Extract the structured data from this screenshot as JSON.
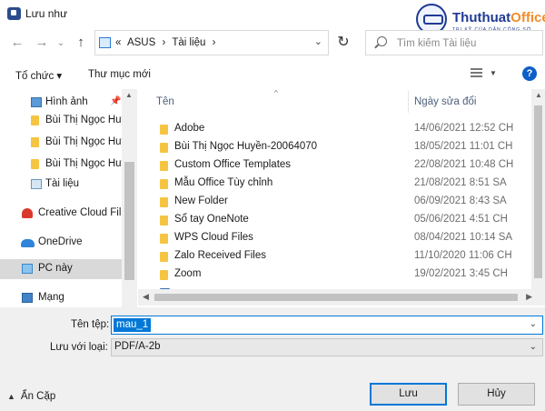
{
  "window": {
    "title": "Lưu như"
  },
  "watermark": {
    "brand_part1": "Thuthuat",
    "brand_part2": "Office",
    "tagline": "TRI KỸ CỦA DÂN CÔNG SỞ"
  },
  "address": {
    "overflow": "«",
    "crumbs": [
      "ASUS",
      "›",
      "Tài liệu",
      "›"
    ],
    "refresh_icon": "refresh-icon"
  },
  "search": {
    "placeholder": "Tìm kiếm Tài liệu"
  },
  "toolbar": {
    "organize": "Tổ chức ▾",
    "new_folder": "Thư mục mới",
    "help": "?"
  },
  "nav": {
    "items": [
      {
        "label": "Hình ảnh",
        "icon": "image-icon",
        "pinned": true
      },
      {
        "label": "Bùi Thị Ngọc Huyền",
        "icon": "folder-icon"
      },
      {
        "label": "Bùi Thị Ngọc Huyền",
        "icon": "folder-icon"
      },
      {
        "label": "Bùi Thị Ngọc Huyền",
        "icon": "folder-icon"
      },
      {
        "label": "Tài liệu",
        "icon": "document-icon"
      },
      {
        "label": "Creative Cloud Files",
        "icon": "creative-cloud-icon"
      },
      {
        "label": "OneDrive",
        "icon": "onedrive-icon"
      },
      {
        "label": "PC này",
        "icon": "pc-icon",
        "selected": true
      },
      {
        "label": "Mạng",
        "icon": "network-icon"
      }
    ]
  },
  "files": {
    "columns": {
      "name": "Tên",
      "date": "Ngày sửa đổi"
    },
    "rows": [
      {
        "name": "Adobe",
        "date": "14/06/2021 12:52 CH"
      },
      {
        "name": "Bùi Thị Ngọc Huyền-20064070",
        "date": "18/05/2021 11:01 CH"
      },
      {
        "name": "Custom Office Templates",
        "date": "22/08/2021 10:48 CH"
      },
      {
        "name": "Mẫu Office Tùy chỉnh",
        "date": "21/08/2021 8:51 SA"
      },
      {
        "name": "New Folder",
        "date": "06/09/2021 8:43 SA"
      },
      {
        "name": "Sổ tay OneNote",
        "date": "05/06/2021 4:51 CH"
      },
      {
        "name": "WPS Cloud Files",
        "date": "08/04/2021 10:14 SA"
      },
      {
        "name": "Zalo Received Files",
        "date": "11/10/2020 11:06 CH"
      },
      {
        "name": "Zoom",
        "date": "19/02/2021 3:45 CH"
      }
    ]
  },
  "save": {
    "filename_label": "Tên tệp:",
    "filename_value": "mau_1",
    "type_label": "Lưu với loại:",
    "type_value": "PDF/A-2b",
    "hide_folders": "Ẩn Cặp",
    "save_button": "Lưu",
    "cancel_button": "Hủy"
  }
}
